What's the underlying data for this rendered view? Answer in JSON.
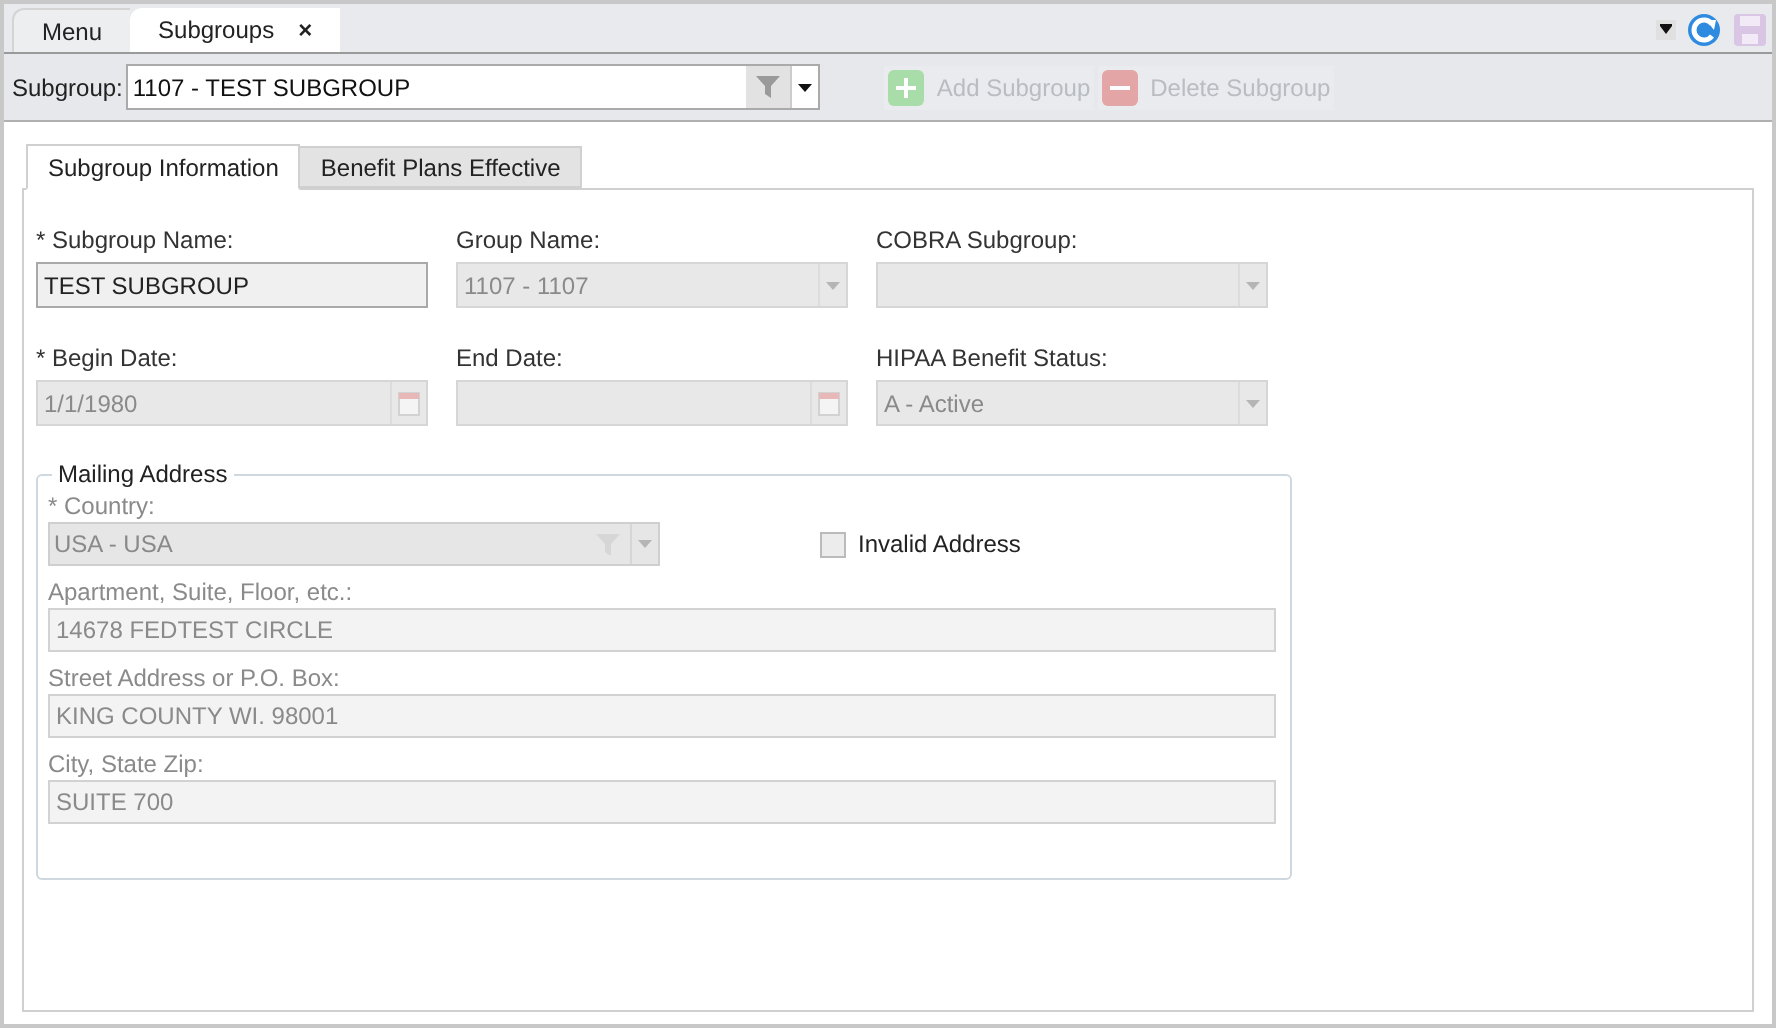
{
  "doc_tabs": [
    {
      "label": "Menu",
      "selected": false,
      "closable": false
    },
    {
      "label": "Subgroups",
      "selected": true,
      "closable": true,
      "close": "×"
    }
  ],
  "toolbar": {
    "label": "Subgroup:",
    "value": "1107 - TEST SUBGROUP",
    "buttons": [
      {
        "kind": "add",
        "label": "Add Subgroup",
        "disabled": true
      },
      {
        "kind": "delete",
        "label": "Delete Subgroup",
        "disabled": true
      }
    ]
  },
  "tabs": [
    {
      "label": "Subgroup Information",
      "selected": true
    },
    {
      "label": "Benefit Plans Effective",
      "selected": false
    }
  ],
  "fields": [
    {
      "label": "* Subgroup Name:",
      "kind": "text",
      "value": "TEST SUBGROUP",
      "disabled": false
    },
    {
      "label": "Group Name:",
      "kind": "select",
      "value": "1107 - 1107",
      "disabled": true
    },
    {
      "label": "COBRA Subgroup:",
      "kind": "select",
      "disabled": true
    },
    {
      "label": "* Begin Date:",
      "kind": "date",
      "value": "1/1/1980",
      "disabled": true
    },
    {
      "label": "End Date:",
      "kind": "date",
      "disabled": true
    },
    {
      "label": "HIPAA Benefit Status:",
      "kind": "select",
      "value": "A - Active",
      "disabled": true
    }
  ],
  "mailing_address": {
    "title": "Mailing Address",
    "country": {
      "label": "* Country:",
      "value": "USA - USA",
      "disabled": true
    },
    "invalid_address": {
      "label": "Invalid Address",
      "checked": false
    },
    "lines": [
      {
        "label": "Apartment, Suite, Floor, etc.:",
        "value": "14678 FEDTEST CIRCLE",
        "disabled": true
      },
      {
        "label": "Street Address or P.O. Box:",
        "value": "KING COUNTY WI. 98001",
        "disabled": true
      },
      {
        "label": "City, State Zip:",
        "value": "SUITE 700",
        "disabled": true
      }
    ]
  }
}
